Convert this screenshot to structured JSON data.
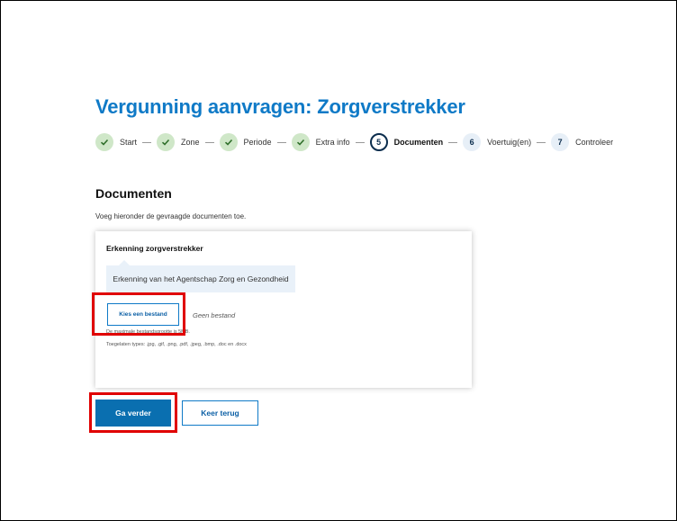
{
  "page": {
    "title": "Vergunning aanvragen: Zorgverstrekker"
  },
  "steps": [
    {
      "label": "Start",
      "status": "done",
      "icon": "check-icon"
    },
    {
      "label": "Zone",
      "status": "done",
      "icon": "check-icon"
    },
    {
      "label": "Periode",
      "status": "done",
      "icon": "check-icon"
    },
    {
      "label": "Extra info",
      "status": "done",
      "icon": "check-icon"
    },
    {
      "label": "Documenten",
      "status": "active",
      "number": "5"
    },
    {
      "label": "Voertuig(en)",
      "status": "todo",
      "number": "6"
    },
    {
      "label": "Controleer",
      "status": "todo",
      "number": "7"
    }
  ],
  "section": {
    "title": "Documenten",
    "intro": "Voeg hieronder de gevraagde documenten toe."
  },
  "upload": {
    "title": "Erkenning zorgverstrekker",
    "info": "Erkenning van het Agentschap Zorg en Gezondheid",
    "choose_file_label": "Kies een bestand",
    "no_file_text": "Geen bestand",
    "max_size_text": "De maximale bestandsgrootte is 5MB.",
    "allowed_types_text": "Toegelaten types: .jpg, .gif, .png, .pdf, .jpeg, .bmp, .doc en .docx"
  },
  "actions": {
    "next_label": "Ga verder",
    "back_label": "Keer terug"
  },
  "colors": {
    "title_blue": "#0f7ac7",
    "primary": "#0a6fb0",
    "done_bg": "#cfe7c8",
    "highlight": "#e00000"
  }
}
